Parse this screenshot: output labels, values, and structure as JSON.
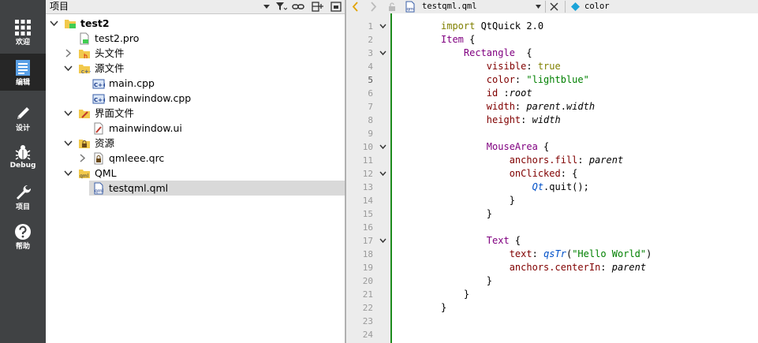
{
  "mode_bar": {
    "items": [
      {
        "label": "欢迎",
        "icon": "grid-icon",
        "active": false
      },
      {
        "label": "编辑",
        "icon": "edit-document-icon",
        "active": true
      },
      {
        "label": "设计",
        "icon": "pencil-icon",
        "active": false
      },
      {
        "label": "Debug",
        "icon": "bug-icon",
        "active": false
      },
      {
        "label": "项目",
        "icon": "wrench-icon",
        "active": false
      },
      {
        "label": "帮助",
        "icon": "help-icon",
        "active": false
      }
    ]
  },
  "project_panel": {
    "title": "项目",
    "tree": [
      {
        "label": "test2",
        "icon": "qt-project-folder-icon",
        "expanded": true,
        "bold": true
      },
      {
        "label": "test2.pro",
        "icon": "pro-file-icon"
      },
      {
        "label": "头文件",
        "icon": "header-folder-icon",
        "expanded": false
      },
      {
        "label": "源文件",
        "icon": "source-folder-icon",
        "expanded": true
      },
      {
        "label": "main.cpp",
        "icon": "cpp-file-icon"
      },
      {
        "label": "mainwindow.cpp",
        "icon": "cpp-file-icon"
      },
      {
        "label": "界面文件",
        "icon": "forms-folder-icon",
        "expanded": true
      },
      {
        "label": "mainwindow.ui",
        "icon": "ui-file-icon"
      },
      {
        "label": "资源",
        "icon": "resources-folder-icon",
        "expanded": true
      },
      {
        "label": "qmleee.qrc",
        "icon": "qrc-file-icon",
        "expanded": false
      },
      {
        "label": "QML",
        "icon": "qml-folder-icon",
        "expanded": true
      },
      {
        "label": "testqml.qml",
        "icon": "qml-file-icon",
        "selected": true
      }
    ]
  },
  "editor": {
    "file_name": "testqml.qml",
    "symbol": "color",
    "current_line": 5,
    "line_numbers": [
      "1",
      "2",
      "3",
      "4",
      "5",
      "6",
      "7",
      "8",
      "9",
      "10",
      "11",
      "12",
      "13",
      "14",
      "15",
      "16",
      "17",
      "18",
      "19",
      "20",
      "21",
      "22",
      "23",
      "24"
    ],
    "lines": [
      "import QtQuick 2.0",
      "Item {",
      "    Rectangle  {",
      "        visible: true",
      "        color: \"lightblue\"",
      "        id :root",
      "        width: parent.width",
      "        height: width",
      "",
      "        MouseArea {",
      "            anchors.fill: parent",
      "            onClicked: {",
      "                Qt.quit();",
      "            }",
      "        }",
      "",
      "        Text {",
      "            text: qsTr(\"Hello World\")",
      "            anchors.centerIn: parent",
      "        }",
      "    }",
      "}",
      "",
      ""
    ]
  },
  "colors": {
    "mode_bar_bg": "#404244",
    "mode_active_bg": "#262626",
    "keyword": "#808000",
    "type": "#800080",
    "property": "#800000",
    "string": "#008000",
    "function": "#0050c8",
    "gutter_bar": "#1e8c1e"
  }
}
